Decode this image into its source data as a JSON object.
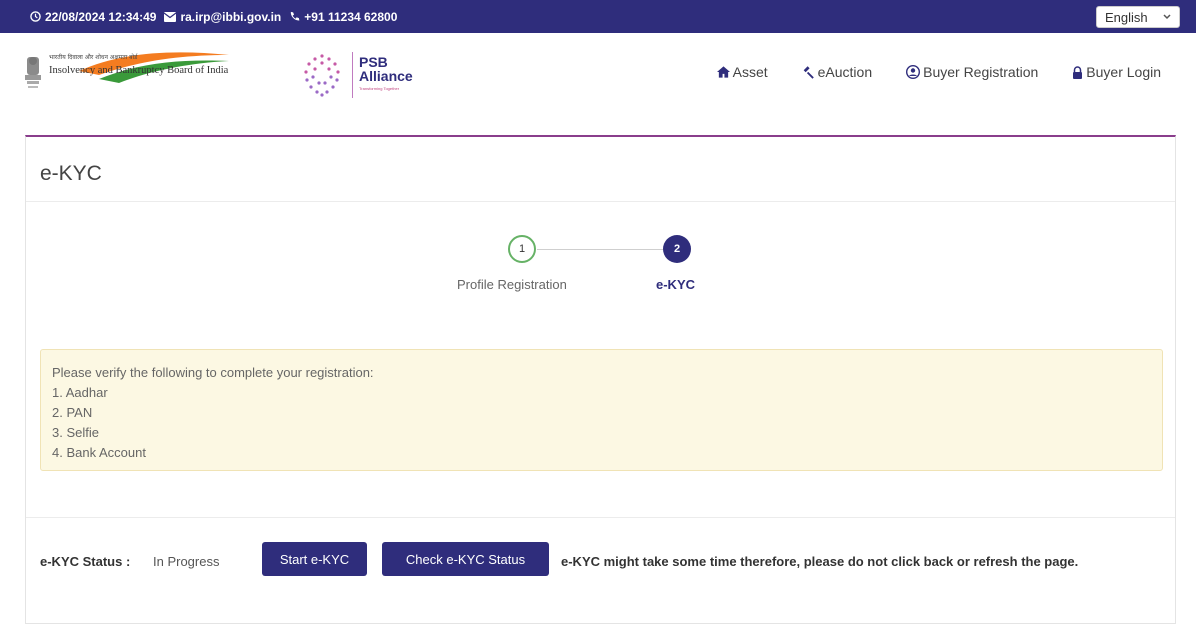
{
  "topbar": {
    "datetime": "22/08/2024 12:34:49",
    "email": "ra.irp@ibbi.gov.in",
    "phone": "+91 11234 62800",
    "language": "English"
  },
  "header": {
    "ibbi_text_hindi": "भारतीय दिवाला और शोधन अक्षमता बोर्ड",
    "ibbi_text_en": "Insolvency and Bankruptcy Board of India",
    "psb_line1": "PSB",
    "psb_line2": "Alliance",
    "psb_tagline": "Transforming Together",
    "nav": [
      {
        "label": "Asset",
        "icon": "home-icon"
      },
      {
        "label": "eAuction",
        "icon": "gavel-icon"
      },
      {
        "label": "Buyer Registration",
        "icon": "user-circle-icon"
      },
      {
        "label": "Buyer Login",
        "icon": "lock-icon"
      }
    ]
  },
  "card": {
    "title": "e-KYC",
    "steps": [
      {
        "number": "1",
        "label": "Profile Registration"
      },
      {
        "number": "2",
        "label": "e-KYC"
      }
    ],
    "notice": {
      "heading": "Please verify the following to complete your registration:",
      "items": [
        "1. Aadhar",
        "2. PAN",
        "3. Selfie",
        "4. Bank Account"
      ]
    },
    "footer": {
      "status_label": "e-KYC Status :",
      "status_value": "In Progress",
      "start_button": "Start e-KYC",
      "check_button": "Check e-KYC Status",
      "warning": "e-KYC might take some time therefore, please do not click back or refresh the page."
    }
  },
  "colors": {
    "primary": "#2f2d7c",
    "accent_border": "#8a3d8c",
    "step_done": "#66b266",
    "notice_bg": "#fcf8e3"
  }
}
